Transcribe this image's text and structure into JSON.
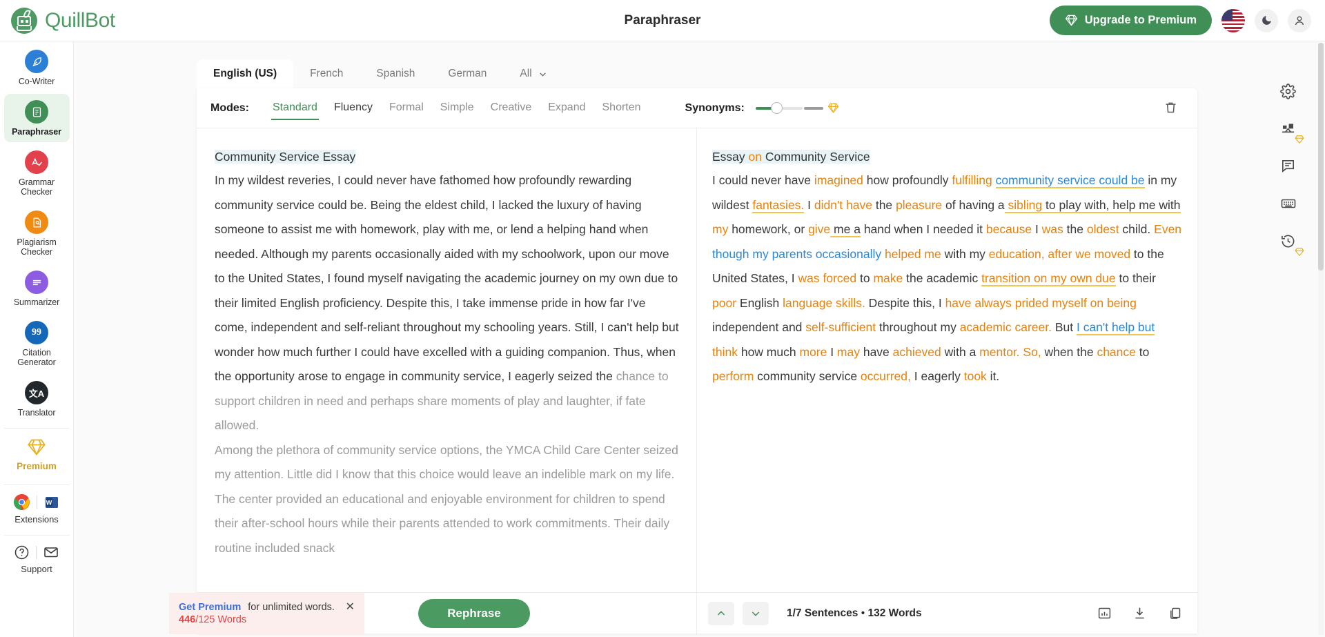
{
  "brand": {
    "name": "QuillBot",
    "logo_icon": "quillbot-robot-icon"
  },
  "header": {
    "title": "Paraphraser",
    "upgrade_label": "Upgrade to Premium",
    "upgrade_icon": "diamond-icon",
    "flag_icon": "us-flag-icon",
    "theme_icon": "moon-icon",
    "account_icon": "user-avatar-icon",
    "accent_color": "#3f8f56"
  },
  "sidebar": {
    "items": [
      {
        "label": "Co-Writer",
        "icon": "feather-pen-icon",
        "color": "#2b7fd4",
        "active": false
      },
      {
        "label": "Paraphraser",
        "icon": "document-refresh-icon",
        "color": "#3f8f56",
        "active": true
      },
      {
        "label": "Grammar\nChecker",
        "icon": "letter-a-check-icon",
        "color": "#e2414c",
        "active": false
      },
      {
        "label": "Plagiarism\nChecker",
        "icon": "document-search-icon",
        "color": "#ef8a12",
        "active": false
      },
      {
        "label": "Summarizer",
        "icon": "lines-list-icon",
        "color": "#8e5ce0",
        "active": false
      },
      {
        "label": "Citation\nGenerator",
        "icon": "quotation-marks-icon",
        "color": "#1567b8",
        "active": false
      },
      {
        "label": "Translator",
        "icon": "translate-icon",
        "color": "#22272b",
        "active": false
      }
    ],
    "premium": {
      "label": "Premium",
      "icon": "gold-diamond-icon",
      "color": "#d6a020"
    },
    "extensions": {
      "label": "Extensions",
      "icons": [
        "chrome-icon",
        "microsoft-word-icon"
      ]
    },
    "support": {
      "label": "Support",
      "icons": [
        "help-circle-icon",
        "envelope-icon"
      ]
    }
  },
  "language_tabs": [
    {
      "label": "English (US)",
      "active": true
    },
    {
      "label": "French",
      "active": false
    },
    {
      "label": "Spanish",
      "active": false
    },
    {
      "label": "German",
      "active": false
    },
    {
      "label": "All",
      "active": false,
      "icon": "chevron-down-icon"
    }
  ],
  "modes": {
    "label": "Modes:",
    "items": [
      {
        "label": "Standard",
        "state": "active"
      },
      {
        "label": "Fluency",
        "state": "enabled"
      },
      {
        "label": "Formal",
        "state": "locked"
      },
      {
        "label": "Simple",
        "state": "locked"
      },
      {
        "label": "Creative",
        "state": "locked"
      },
      {
        "label": "Expand",
        "state": "locked"
      },
      {
        "label": "Shorten",
        "state": "locked"
      }
    ],
    "synonyms_label": "Synonyms:",
    "synonyms_value": 25,
    "synonyms_premium_icon": "gold-diamond-icon",
    "trash_icon": "trash-icon"
  },
  "input_panel": {
    "title": "Community Service Essay",
    "paragraphs": [
      "In my wildest reveries, I could never have fathomed how profoundly rewarding community service could be. Being the eldest child, I lacked the luxury of having someone to assist me with homework, play with me, or lend a helping hand when needed. Although my parents occasionally aided with my schoolwork, upon our move to the United States, I found myself navigating the academic journey on my own due to their limited English proficiency. Despite this, I take immense pride in how far I've come, independent and self-reliant throughout my schooling years. Still, I can't help but wonder how much further I could have excelled with a guiding companion. Thus, when the opportunity arose to engage in community service, I eagerly seized the ",
      "Among the plethora of community service options, the YMCA Child Care Center seized my attention. Little did I know that this choice would leave an indelible mark on my life. The center provided an educational and enjoyable environment for children to spend their after-school hours while their parents attended to work commitments. Their daily routine included snack"
    ],
    "overflow_text": "chance to support children in need and perhaps share moments of play and laughter, if fate allowed."
  },
  "output_panel": {
    "title_parts": [
      {
        "text": "Essay ",
        "style": "plain"
      },
      {
        "text": "on",
        "style": "orange"
      },
      {
        "text": " Community Service",
        "style": "plain"
      }
    ],
    "body_parts": [
      {
        "text": "I could never have ",
        "style": "plain"
      },
      {
        "text": "imagined",
        "style": "orange"
      },
      {
        "text": " how profoundly ",
        "style": "plain"
      },
      {
        "text": "fulfilling",
        "style": "orange"
      },
      {
        "text": " ",
        "style": "plain"
      },
      {
        "text": "community service could be",
        "style": "blue-underline"
      },
      {
        "text": " in my wildest ",
        "style": "plain"
      },
      {
        "text": "fantasies.",
        "style": "orange-underline"
      },
      {
        "text": " I ",
        "style": "plain"
      },
      {
        "text": "didn't have",
        "style": "orange"
      },
      {
        "text": " the ",
        "style": "plain"
      },
      {
        "text": "pleasure",
        "style": "orange"
      },
      {
        "text": " of having a",
        "style": "plain"
      },
      {
        "text": " sibling",
        "style": "orange-underline"
      },
      {
        "text": " to play with, help me with",
        "style": "underline-only"
      },
      {
        "text": " ",
        "style": "plain"
      },
      {
        "text": "my",
        "style": "orange"
      },
      {
        "text": " homework, or ",
        "style": "plain"
      },
      {
        "text": "give",
        "style": "orange"
      },
      {
        "text": " me a",
        "style": "underline-only"
      },
      {
        "text": " hand when I needed it ",
        "style": "plain"
      },
      {
        "text": "because",
        "style": "orange"
      },
      {
        "text": " I ",
        "style": "plain"
      },
      {
        "text": "was",
        "style": "orange"
      },
      {
        "text": " the ",
        "style": "plain"
      },
      {
        "text": "oldest",
        "style": "orange"
      },
      {
        "text": " child. ",
        "style": "plain"
      },
      {
        "text": "Even",
        "style": "orange"
      },
      {
        "text": " ",
        "style": "plain"
      },
      {
        "text": "though my parents occasionally",
        "style": "blue"
      },
      {
        "text": " ",
        "style": "plain"
      },
      {
        "text": "helped me",
        "style": "orange"
      },
      {
        "text": " with my ",
        "style": "plain"
      },
      {
        "text": "education, after we moved",
        "style": "orange"
      },
      {
        "text": " to the United States, I ",
        "style": "plain"
      },
      {
        "text": "was forced",
        "style": "orange"
      },
      {
        "text": " to ",
        "style": "plain"
      },
      {
        "text": "make",
        "style": "orange"
      },
      {
        "text": " the academic ",
        "style": "plain"
      },
      {
        "text": "transition on my own due",
        "style": "orange-underline"
      },
      {
        "text": " to their ",
        "style": "plain"
      },
      {
        "text": "poor",
        "style": "orange"
      },
      {
        "text": " English ",
        "style": "plain"
      },
      {
        "text": "language skills.",
        "style": "orange"
      },
      {
        "text": " Despite this, I ",
        "style": "plain"
      },
      {
        "text": "have always prided myself on being",
        "style": "orange"
      },
      {
        "text": " independent and ",
        "style": "plain"
      },
      {
        "text": "self-sufficient",
        "style": "orange"
      },
      {
        "text": " throughout my ",
        "style": "plain"
      },
      {
        "text": "academic career.",
        "style": "orange"
      },
      {
        "text": " But ",
        "style": "plain"
      },
      {
        "text": "I can't help but",
        "style": "blue-underline"
      },
      {
        "text": " ",
        "style": "plain"
      },
      {
        "text": "think",
        "style": "orange"
      },
      {
        "text": " how much ",
        "style": "plain"
      },
      {
        "text": "more",
        "style": "orange"
      },
      {
        "text": " I ",
        "style": "plain"
      },
      {
        "text": "may",
        "style": "orange"
      },
      {
        "text": " have ",
        "style": "plain"
      },
      {
        "text": "achieved",
        "style": "orange"
      },
      {
        "text": " with a ",
        "style": "plain"
      },
      {
        "text": "mentor. So,",
        "style": "orange"
      },
      {
        "text": " when the ",
        "style": "plain"
      },
      {
        "text": "chance",
        "style": "orange"
      },
      {
        "text": " to ",
        "style": "plain"
      },
      {
        "text": "perform",
        "style": "orange"
      },
      {
        "text": " community service ",
        "style": "plain"
      },
      {
        "text": "occurred,",
        "style": "orange"
      },
      {
        "text": " I eagerly ",
        "style": "plain"
      },
      {
        "text": "took",
        "style": "orange"
      },
      {
        "text": " it.",
        "style": "plain"
      }
    ]
  },
  "input_footer": {
    "banner_link": "Get Premium",
    "banner_text": "for unlimited words.",
    "close_icon": "close-x-icon",
    "word_count_used": "446",
    "word_count_rest": "/125 Words",
    "rephrase_label": "Rephrase"
  },
  "output_footer": {
    "prev_icon": "chevron-up-icon",
    "next_icon": "chevron-down-icon",
    "stats_sentence": "1/7 Sentences",
    "stats_separator": "•",
    "stats_words": "132 Words",
    "tools": [
      "chart-bar-icon",
      "download-icon",
      "copy-icon"
    ]
  },
  "right_rail": {
    "items": [
      {
        "icon": "gear-icon",
        "premium": false
      },
      {
        "icon": "compare-balance-icon",
        "premium": true
      },
      {
        "icon": "comment-icon",
        "premium": false
      },
      {
        "icon": "keyboard-icon",
        "premium": false
      },
      {
        "icon": "history-clock-icon",
        "premium": true
      }
    ]
  },
  "colors": {
    "brand_green": "#4e9a63",
    "accent_green": "#3f8f56",
    "orange": "#e8820c",
    "blue": "#2b88d8",
    "underline_yellow": "#f0c64a",
    "premium_gold": "#d6a020",
    "alert_red": "#e04545"
  }
}
